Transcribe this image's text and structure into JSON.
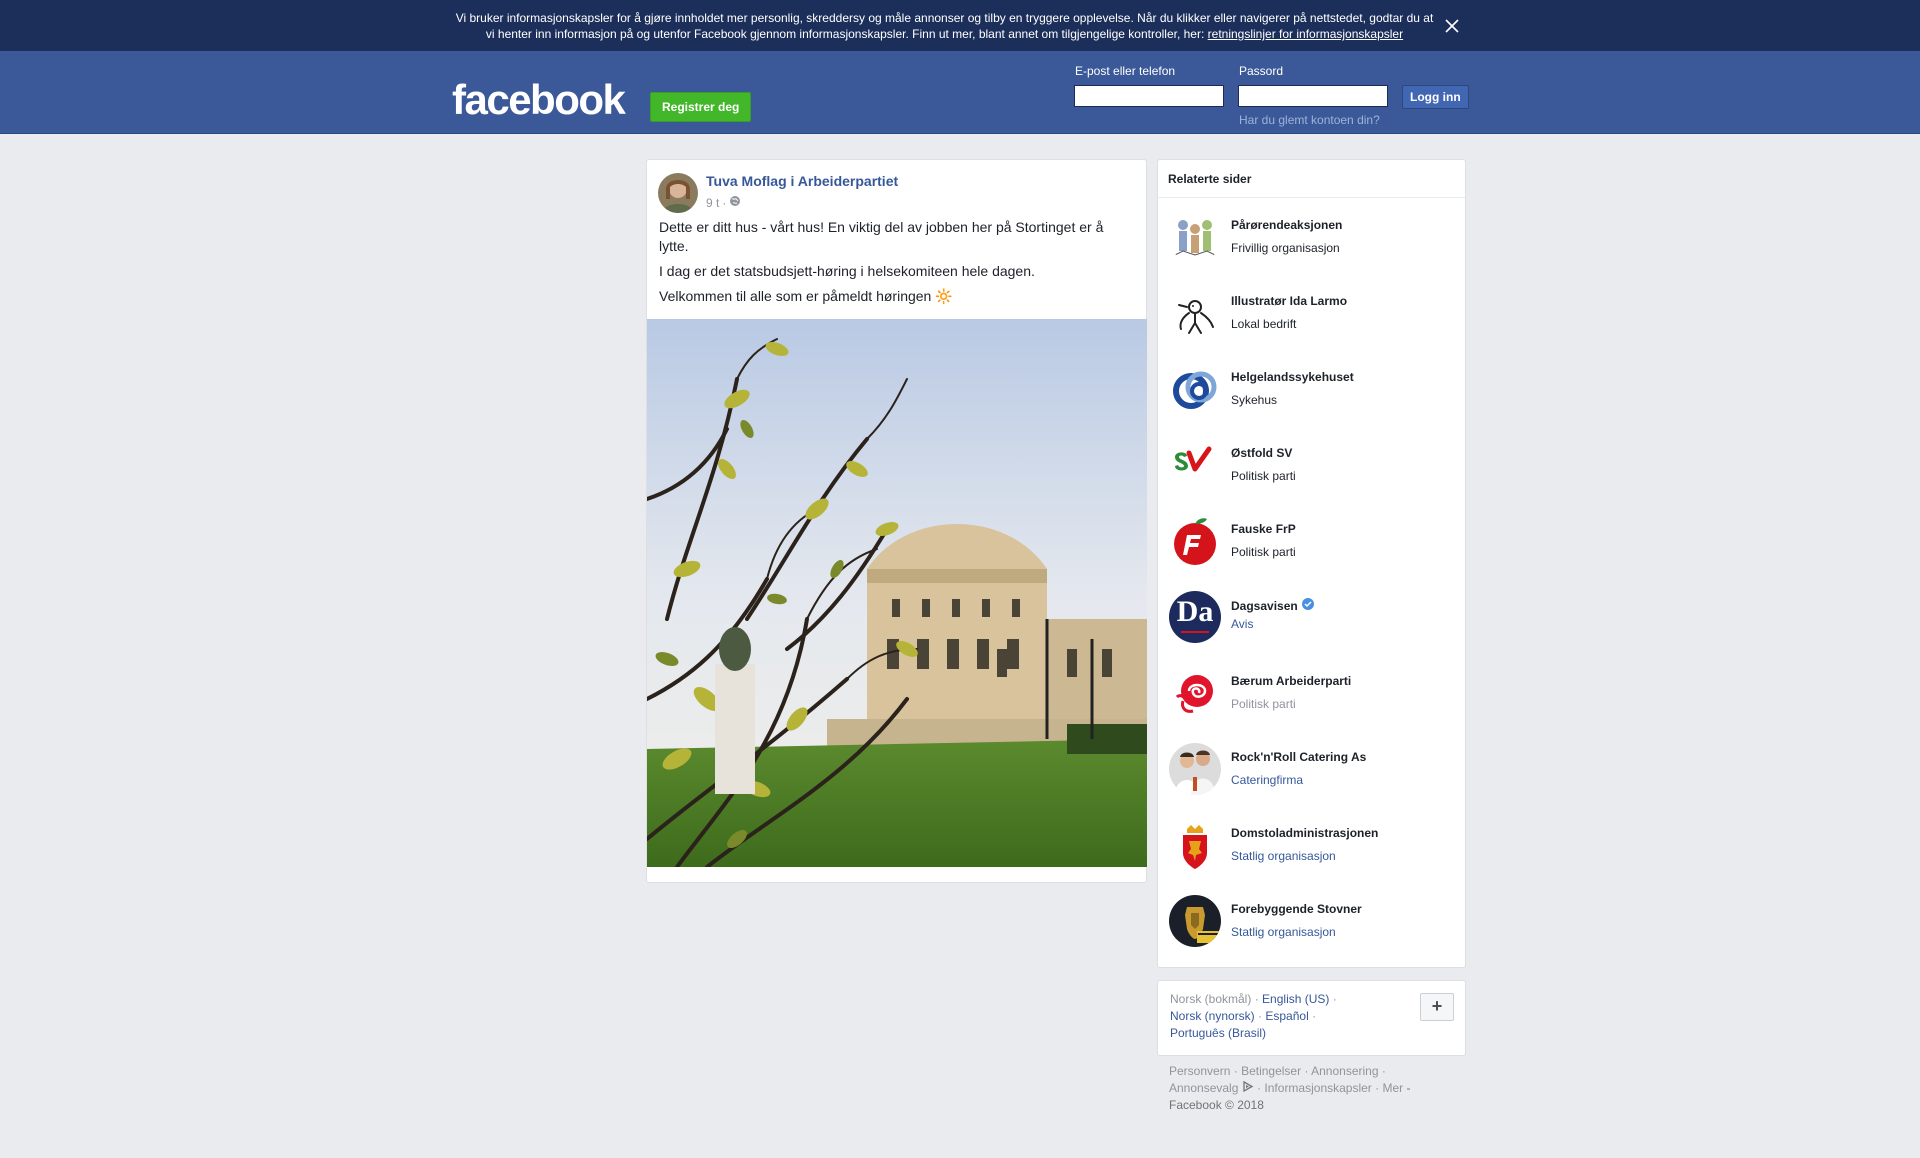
{
  "cookie_banner": {
    "text": "Vi bruker informasjonskapsler for å gjøre innholdet mer personlig, skreddersy og måle annonser og tilby en tryggere opplevelse. Når du klikker eller navigerer på nettstedet, godtar du at vi henter inn informasjon på og utenfor Facebook gjennom informasjonskapsler. Finn ut mer, blant annet om tilgjengelige kontroller, her: ",
    "link_text": "retningslinjer for informasjonskapsler"
  },
  "header": {
    "logo": "facebook",
    "register_label": "Registrer deg",
    "email_label": "E-post eller telefon",
    "email_value": "",
    "password_label": "Passord",
    "password_value": "",
    "login_label": "Logg inn",
    "forgot_label": "Har du glemt kontoen din?"
  },
  "post": {
    "author": "Tuva Moflag i Arbeiderpartiet",
    "time": "9 t",
    "separator": "·",
    "paragraphs": [
      "Dette er ditt hus - vårt hus! En viktig del av jobben her på Stortinget er å lytte.",
      "I dag er det statsbudsjett-høring i helsekomiteen hele dagen.",
      "Velkommen til alle som er påmeldt høringen 🔆"
    ]
  },
  "related": {
    "title": "Relaterte sider",
    "items": [
      {
        "name": "Pårørendeaksjonen",
        "category": "Frivillig organisasjon",
        "style": ""
      },
      {
        "name": "Illustratør Ida Larmo",
        "category": "Lokal bedrift",
        "style": ""
      },
      {
        "name": "Helgelandssykehuset",
        "category": "Sykehus",
        "style": ""
      },
      {
        "name": "Østfold SV",
        "category": "Politisk parti",
        "style": ""
      },
      {
        "name": "Fauske FrP",
        "category": "Politisk parti",
        "style": ""
      },
      {
        "name": "Dagsavisen",
        "category": "Avis",
        "style": "blue"
      },
      {
        "name": "Bærum Arbeiderparti",
        "category": "Politisk parti",
        "style": "grey"
      },
      {
        "name": "Rock'n'Roll Catering As",
        "category": "Cateringfirma",
        "style": "blue"
      },
      {
        "name": "Domstoladministrasjonen",
        "category": "Statlig organisasjon",
        "style": "blue"
      },
      {
        "name": "Forebyggende Stovner",
        "category": "Statlig organisasjon",
        "style": "blue"
      }
    ],
    "dagsavisen_logo_text": "Da"
  },
  "languages": {
    "current": "Norsk (bokmål)",
    "english": "English (US)",
    "nynorsk": "Norsk (nynorsk)",
    "spanish": "Español",
    "portuguese": "Português (Brasil)",
    "sep": "·",
    "plus": "+"
  },
  "footer": {
    "privacy": "Personvern",
    "terms": "Betingelser",
    "ads": "Annonsering",
    "ad_choices": "Annonsevalg",
    "cookies": "Informasjonskapsler",
    "more": "Mer",
    "sep": "·",
    "dash": "-",
    "copyright": "Facebook © 2018"
  },
  "colors": {
    "brand_blue": "#3b5998",
    "banner_blue": "#1c2f5b",
    "link_blue": "#365899",
    "register_green": "#42b72a"
  },
  "icons": {
    "close": "close-icon",
    "globe": "globe-icon",
    "verified": "verified-badge-icon",
    "adchoices": "adchoices-icon"
  }
}
